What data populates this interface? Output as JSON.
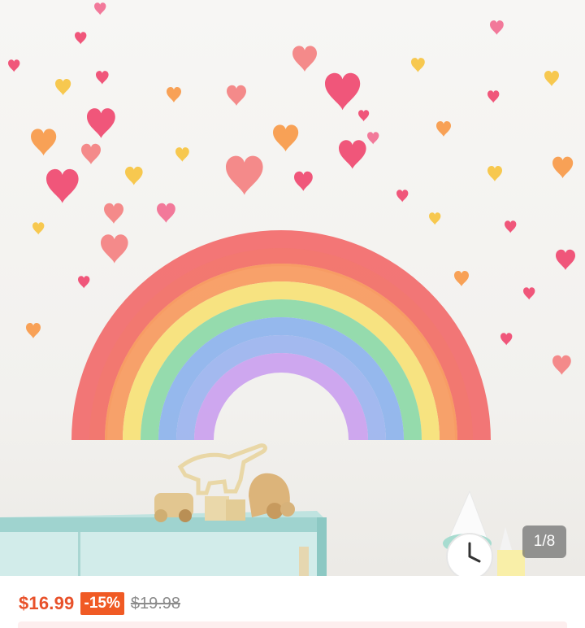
{
  "gallery": {
    "page_indicator": "1/8",
    "image_alt": "Rainbow and hearts wall sticker",
    "colors": {
      "rainbow": [
        "#f26b6b",
        "#f79a5e",
        "#f7e27a",
        "#8fd9a9",
        "#8fb4ec",
        "#cba2ee"
      ],
      "hearts": [
        "#f0567a",
        "#f48a8a",
        "#f8a156",
        "#f7c84f",
        "#f2799a"
      ]
    }
  },
  "price": {
    "sale": "$16.99",
    "discount": "-15%",
    "original": "$19.98",
    "colors": {
      "accent": "#e8512a",
      "badge": "#f05a24",
      "muted": "#8c8c8c"
    }
  }
}
